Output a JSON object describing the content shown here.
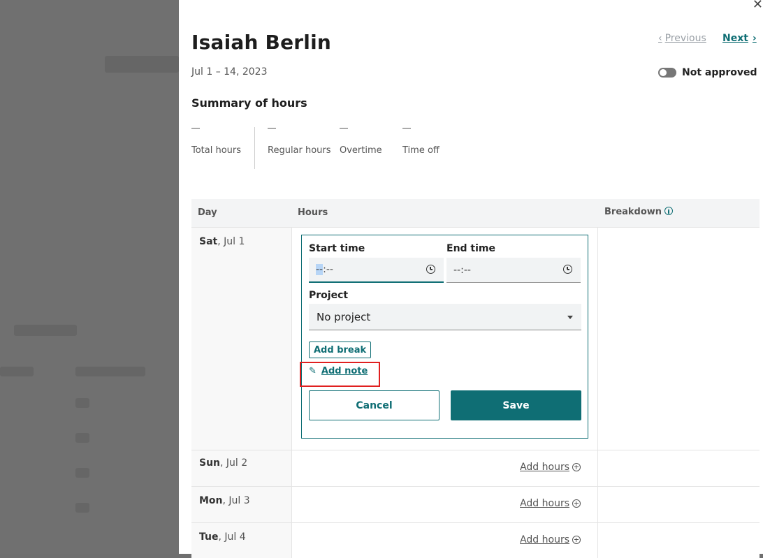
{
  "employee": {
    "name": "Isaiah Berlin",
    "period": "Jul 1 – 14, 2023"
  },
  "nav": {
    "previous": "Previous",
    "next": "Next"
  },
  "approval": {
    "label": "Not approved",
    "on": false
  },
  "summary": {
    "title": "Summary of hours",
    "stats": [
      {
        "value": "—",
        "label": "Total hours"
      },
      {
        "value": "—",
        "label": "Regular hours"
      },
      {
        "value": "—",
        "label": "Overtime"
      },
      {
        "value": "—",
        "label": "Time off"
      }
    ]
  },
  "table": {
    "headers": {
      "day": "Day",
      "hours": "Hours",
      "breakdown": "Breakdown"
    },
    "rows": [
      {
        "weekday": "Sat",
        "date": ", Jul 1"
      },
      {
        "weekday": "Sun",
        "date": ", Jul 2",
        "action": "Add hours"
      },
      {
        "weekday": "Mon",
        "date": ", Jul 3",
        "action": "Add hours"
      },
      {
        "weekday": "Tue",
        "date": ", Jul 4",
        "action": "Add hours"
      }
    ]
  },
  "editor": {
    "start_label": "Start time",
    "start_seg": "--",
    "start_rest": ":--",
    "end_label": "End time",
    "end_value": "--:--",
    "project_label": "Project",
    "project_value": "No project",
    "add_break": "Add break",
    "add_note": "Add note",
    "cancel": "Cancel",
    "save": "Save"
  },
  "colors": {
    "accent": "#0f6e74",
    "highlight": "#e02020"
  }
}
